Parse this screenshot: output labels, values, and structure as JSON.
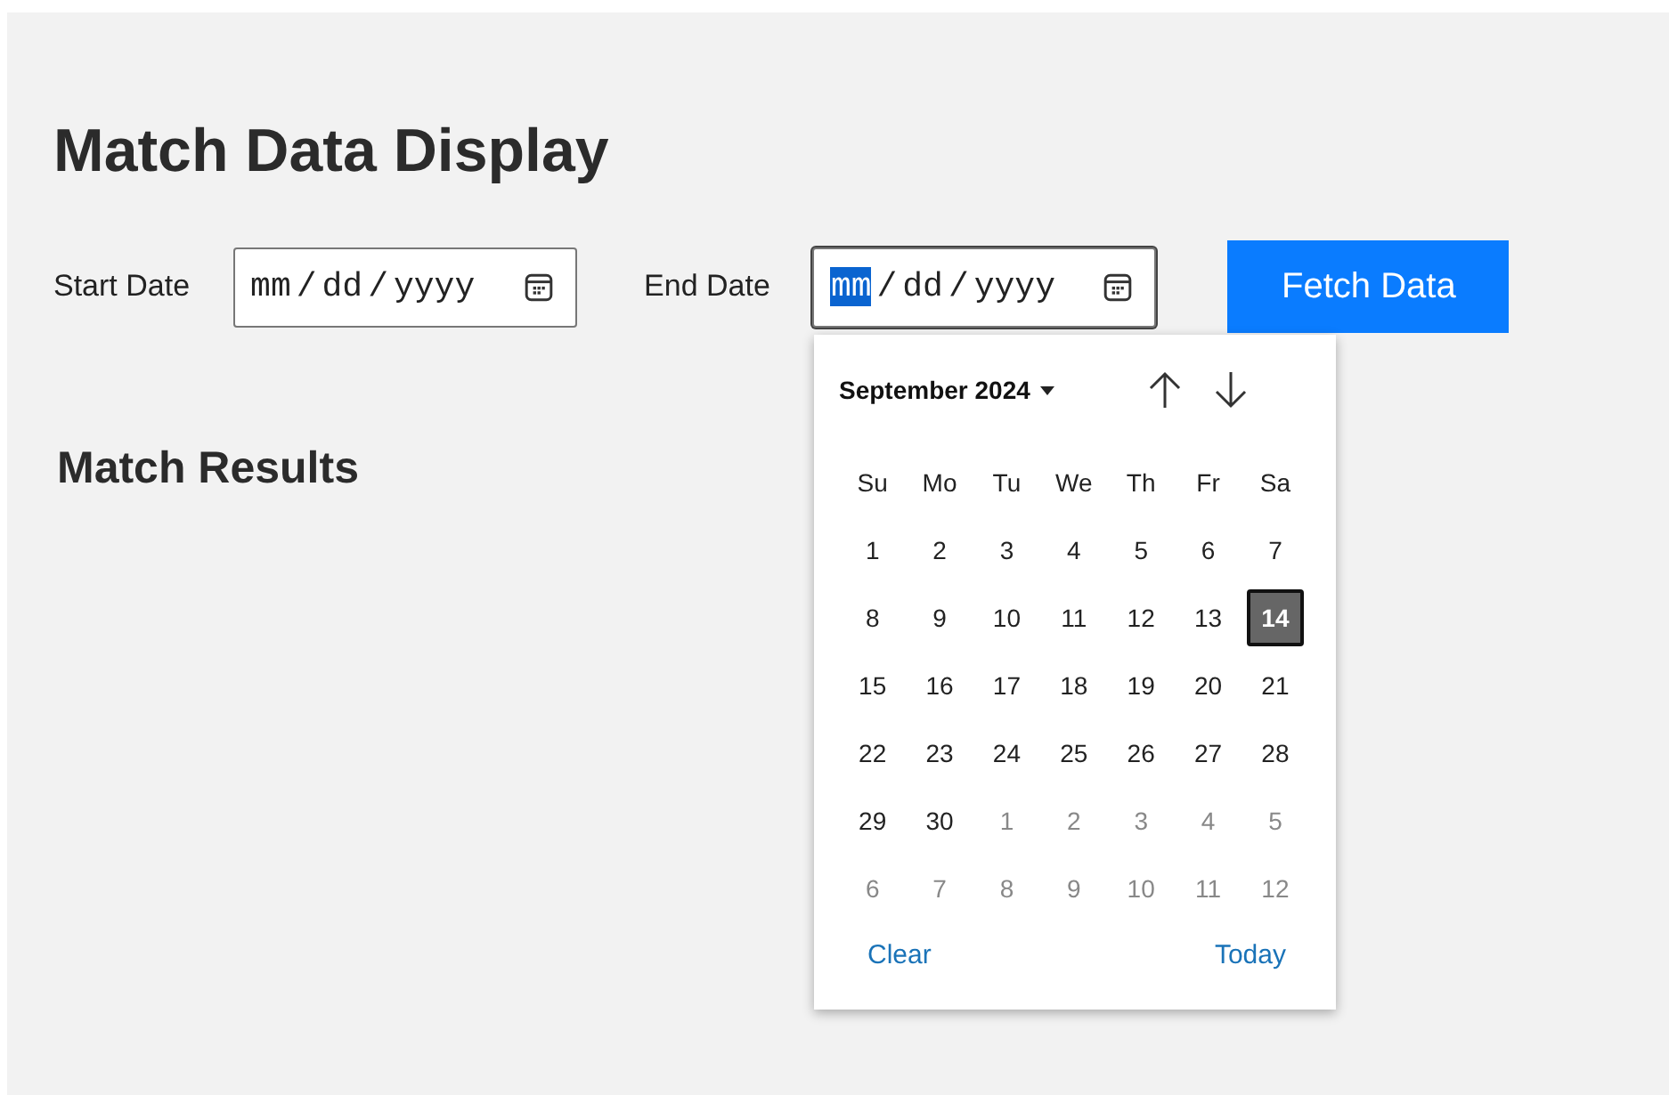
{
  "title": "Match Data Display",
  "filters": [
    {
      "label": "Start Date",
      "focused": false,
      "segments": [
        {
          "text": "mm",
          "selected": false
        },
        {
          "text": "dd",
          "selected": false
        },
        {
          "text": "yyyy",
          "selected": false
        }
      ],
      "separator": "/"
    },
    {
      "label": "End Date",
      "focused": true,
      "segments": [
        {
          "text": "mm",
          "selected": true
        },
        {
          "text": "dd",
          "selected": false
        },
        {
          "text": "yyyy",
          "selected": false
        }
      ],
      "separator": "/"
    }
  ],
  "fetch_button": "Fetch Data",
  "results_heading": "Match Results",
  "calendar": {
    "month": "September 2024",
    "weekdays": [
      "Su",
      "Mo",
      "Tu",
      "We",
      "Th",
      "Fr",
      "Sa"
    ],
    "weeks": [
      [
        {
          "day": "1",
          "in_month": true,
          "selected": false
        },
        {
          "day": "2",
          "in_month": true,
          "selected": false
        },
        {
          "day": "3",
          "in_month": true,
          "selected": false
        },
        {
          "day": "4",
          "in_month": true,
          "selected": false
        },
        {
          "day": "5",
          "in_month": true,
          "selected": false
        },
        {
          "day": "6",
          "in_month": true,
          "selected": false
        },
        {
          "day": "7",
          "in_month": true,
          "selected": false
        }
      ],
      [
        {
          "day": "8",
          "in_month": true,
          "selected": false
        },
        {
          "day": "9",
          "in_month": true,
          "selected": false
        },
        {
          "day": "10",
          "in_month": true,
          "selected": false
        },
        {
          "day": "11",
          "in_month": true,
          "selected": false
        },
        {
          "day": "12",
          "in_month": true,
          "selected": false
        },
        {
          "day": "13",
          "in_month": true,
          "selected": false
        },
        {
          "day": "14",
          "in_month": true,
          "selected": true
        }
      ],
      [
        {
          "day": "15",
          "in_month": true,
          "selected": false
        },
        {
          "day": "16",
          "in_month": true,
          "selected": false
        },
        {
          "day": "17",
          "in_month": true,
          "selected": false
        },
        {
          "day": "18",
          "in_month": true,
          "selected": false
        },
        {
          "day": "19",
          "in_month": true,
          "selected": false
        },
        {
          "day": "20",
          "in_month": true,
          "selected": false
        },
        {
          "day": "21",
          "in_month": true,
          "selected": false
        }
      ],
      [
        {
          "day": "22",
          "in_month": true,
          "selected": false
        },
        {
          "day": "23",
          "in_month": true,
          "selected": false
        },
        {
          "day": "24",
          "in_month": true,
          "selected": false
        },
        {
          "day": "25",
          "in_month": true,
          "selected": false
        },
        {
          "day": "26",
          "in_month": true,
          "selected": false
        },
        {
          "day": "27",
          "in_month": true,
          "selected": false
        },
        {
          "day": "28",
          "in_month": true,
          "selected": false
        }
      ],
      [
        {
          "day": "29",
          "in_month": true,
          "selected": false
        },
        {
          "day": "30",
          "in_month": true,
          "selected": false
        },
        {
          "day": "1",
          "in_month": false,
          "selected": false
        },
        {
          "day": "2",
          "in_month": false,
          "selected": false
        },
        {
          "day": "3",
          "in_month": false,
          "selected": false
        },
        {
          "day": "4",
          "in_month": false,
          "selected": false
        },
        {
          "day": "5",
          "in_month": false,
          "selected": false
        }
      ],
      [
        {
          "day": "6",
          "in_month": false,
          "selected": false
        },
        {
          "day": "7",
          "in_month": false,
          "selected": false
        },
        {
          "day": "8",
          "in_month": false,
          "selected": false
        },
        {
          "day": "9",
          "in_month": false,
          "selected": false
        },
        {
          "day": "10",
          "in_month": false,
          "selected": false
        },
        {
          "day": "11",
          "in_month": false,
          "selected": false
        },
        {
          "day": "12",
          "in_month": false,
          "selected": false
        }
      ]
    ],
    "clear": "Clear",
    "today": "Today"
  }
}
